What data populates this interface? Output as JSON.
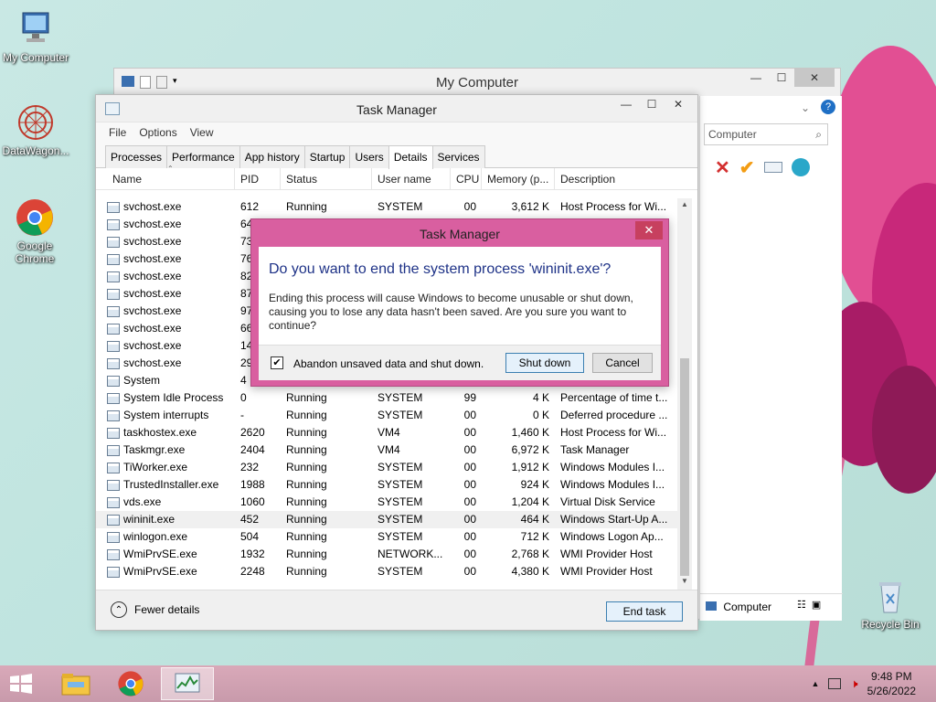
{
  "desktop": {
    "icons": [
      {
        "label": "My Computer"
      },
      {
        "label": "DataWagon..."
      },
      {
        "label": "Google Chrome"
      },
      {
        "label": "Recycle Bin"
      }
    ]
  },
  "my_computer": {
    "title": "My Computer",
    "search_placeholder": "Computer",
    "status_label": "Computer"
  },
  "task_manager": {
    "title": "Task Manager",
    "menu": [
      "File",
      "Options",
      "View"
    ],
    "tabs": [
      "Processes",
      "Performance",
      "App history",
      "Startup",
      "Users",
      "Details",
      "Services"
    ],
    "active_tab": "Details",
    "columns": [
      "Name",
      "PID",
      "Status",
      "User name",
      "CPU",
      "Memory (p...",
      "Description"
    ],
    "rows": [
      {
        "name": "svchost.exe",
        "pid": "612",
        "status": "Running",
        "user": "SYSTEM",
        "cpu": "00",
        "mem": "3,612 K",
        "desc": "Host Process for Wi..."
      },
      {
        "name": "svchost.exe",
        "pid": "64",
        "status": "",
        "user": "",
        "cpu": "",
        "mem": "",
        "desc": ""
      },
      {
        "name": "svchost.exe",
        "pid": "73",
        "status": "",
        "user": "",
        "cpu": "",
        "mem": "",
        "desc": ""
      },
      {
        "name": "svchost.exe",
        "pid": "76",
        "status": "",
        "user": "",
        "cpu": "",
        "mem": "",
        "desc": ""
      },
      {
        "name": "svchost.exe",
        "pid": "82",
        "status": "",
        "user": "",
        "cpu": "",
        "mem": "",
        "desc": ""
      },
      {
        "name": "svchost.exe",
        "pid": "87",
        "status": "",
        "user": "",
        "cpu": "",
        "mem": "",
        "desc": ""
      },
      {
        "name": "svchost.exe",
        "pid": "97",
        "status": "",
        "user": "",
        "cpu": "",
        "mem": "",
        "desc": ""
      },
      {
        "name": "svchost.exe",
        "pid": "66",
        "status": "",
        "user": "",
        "cpu": "",
        "mem": "",
        "desc": ""
      },
      {
        "name": "svchost.exe",
        "pid": "14",
        "status": "",
        "user": "",
        "cpu": "",
        "mem": "",
        "desc": ""
      },
      {
        "name": "svchost.exe",
        "pid": "29",
        "status": "",
        "user": "",
        "cpu": "",
        "mem": "",
        "desc": ""
      },
      {
        "name": "System",
        "pid": "4",
        "status": "",
        "user": "",
        "cpu": "",
        "mem": "",
        "desc": ""
      },
      {
        "name": "System Idle Process",
        "pid": "0",
        "status": "Running",
        "user": "SYSTEM",
        "cpu": "99",
        "mem": "4 K",
        "desc": "Percentage of time t..."
      },
      {
        "name": "System interrupts",
        "pid": "-",
        "status": "Running",
        "user": "SYSTEM",
        "cpu": "00",
        "mem": "0 K",
        "desc": "Deferred procedure ..."
      },
      {
        "name": "taskhostex.exe",
        "pid": "2620",
        "status": "Running",
        "user": "VM4",
        "cpu": "00",
        "mem": "1,460 K",
        "desc": "Host Process for Wi..."
      },
      {
        "name": "Taskmgr.exe",
        "pid": "2404",
        "status": "Running",
        "user": "VM4",
        "cpu": "00",
        "mem": "6,972 K",
        "desc": "Task Manager"
      },
      {
        "name": "TiWorker.exe",
        "pid": "232",
        "status": "Running",
        "user": "SYSTEM",
        "cpu": "00",
        "mem": "1,912 K",
        "desc": "Windows Modules I..."
      },
      {
        "name": "TrustedInstaller.exe",
        "pid": "1988",
        "status": "Running",
        "user": "SYSTEM",
        "cpu": "00",
        "mem": "924 K",
        "desc": "Windows Modules I..."
      },
      {
        "name": "vds.exe",
        "pid": "1060",
        "status": "Running",
        "user": "SYSTEM",
        "cpu": "00",
        "mem": "1,204 K",
        "desc": "Virtual Disk Service"
      },
      {
        "name": "wininit.exe",
        "pid": "452",
        "status": "Running",
        "user": "SYSTEM",
        "cpu": "00",
        "mem": "464 K",
        "desc": "Windows Start-Up A..."
      },
      {
        "name": "winlogon.exe",
        "pid": "504",
        "status": "Running",
        "user": "SYSTEM",
        "cpu": "00",
        "mem": "712 K",
        "desc": "Windows Logon Ap..."
      },
      {
        "name": "WmiPrvSE.exe",
        "pid": "1932",
        "status": "Running",
        "user": "NETWORK...",
        "cpu": "00",
        "mem": "2,768 K",
        "desc": "WMI Provider Host"
      },
      {
        "name": "WmiPrvSE.exe",
        "pid": "2248",
        "status": "Running",
        "user": "SYSTEM",
        "cpu": "00",
        "mem": "4,380 K",
        "desc": "WMI Provider Host"
      }
    ],
    "selected_row": "wininit.exe",
    "fewer_details": "Fewer details",
    "end_task": "End task"
  },
  "dialog": {
    "title": "Task Manager",
    "question": "Do you want to end the system process 'wininit.exe'?",
    "body": "Ending this process will cause Windows to become unusable or shut down, causing you to lose any data hasn't been saved. Are you sure you want to continue?",
    "checkbox_label": "Abandon unsaved data and shut down.",
    "checkbox_checked": true,
    "checkmark": "✔",
    "shutdown_label": "Shut down",
    "cancel_label": "Cancel",
    "close_glyph": "✕"
  },
  "taskbar": {
    "time": "9:48 PM",
    "date": "5/26/2022"
  },
  "colors": {
    "dialog_frame": "#d95fa0",
    "taskbar": "#c89aab",
    "question_text": "#1e3287"
  }
}
